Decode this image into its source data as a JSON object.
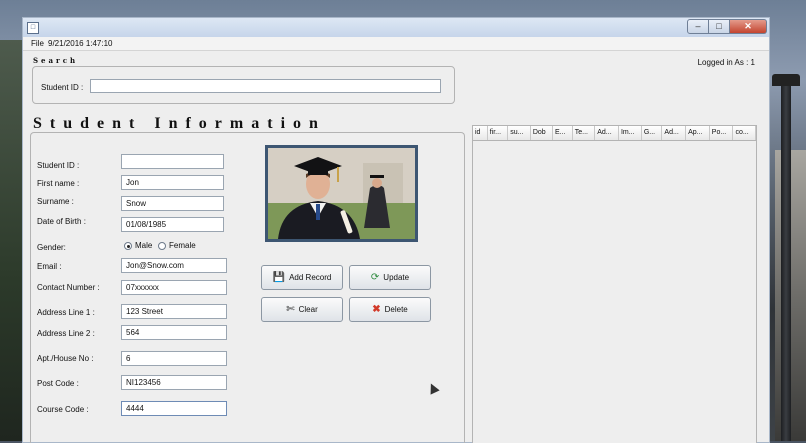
{
  "menubar": {
    "file_label": "File",
    "datetime": "9/21/2016   1:47:10"
  },
  "status": {
    "logged_in": "Logged in As :  1"
  },
  "search": {
    "heading": "Search",
    "student_id_label": "Student ID :",
    "student_id_value": ""
  },
  "form": {
    "heading": "Student Information",
    "fields": {
      "student_id": {
        "label": "Student ID :",
        "value": ""
      },
      "first_name": {
        "label": "First name :",
        "value": "Jon"
      },
      "surname": {
        "label": "Surname :",
        "value": "Snow"
      },
      "dob": {
        "label": "Date of Birth :",
        "value": "01/08/1985"
      },
      "email": {
        "label": "Email :",
        "value": "Jon@Snow.com"
      },
      "contact": {
        "label": "Contact Number :",
        "value": "07xxxxxx"
      },
      "address1": {
        "label": "Address Line 1 :",
        "value": "123 Street"
      },
      "address2": {
        "label": "Address Line 2 :",
        "value": "564"
      },
      "apt": {
        "label": "Apt./House No :",
        "value": "6"
      },
      "postcode": {
        "label": "Post Code :",
        "value": "NI123456"
      },
      "course": {
        "label": "Course Code :",
        "value": "4444"
      }
    },
    "gender": {
      "label": "Gender:",
      "male": "Male",
      "female": "Female",
      "selected": "Male"
    }
  },
  "buttons": {
    "add": "Add Record",
    "update": "Update",
    "clear": "Clear",
    "delete": "Delete"
  },
  "table": {
    "columns": [
      "id",
      "fir...",
      "su...",
      "Dob",
      "E...",
      "Te...",
      "Ad...",
      "Im...",
      "G...",
      "Ad...",
      "Ap...",
      "Po...",
      "co..."
    ]
  },
  "icons": {
    "add": "save-icon",
    "update": "refresh-icon",
    "clear": "scissors-icon",
    "delete": "x-icon"
  },
  "colors": {
    "frame": "#3d5672",
    "titlebar": "#c6d5ea",
    "close": "#c3442f"
  }
}
